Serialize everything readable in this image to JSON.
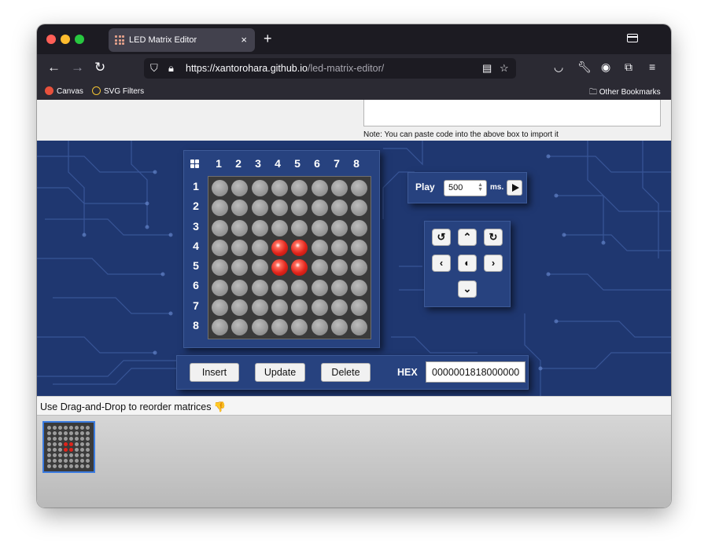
{
  "browser": {
    "tab_title": "LED Matrix Editor",
    "tab_close": "×",
    "new_tab": "+",
    "url_host": "https://xantorohara.github.io",
    "url_path": "/led-matrix-editor/",
    "bookmarks": [
      {
        "label": "Canvas",
        "color": "#e8513c"
      },
      {
        "label": "SVG Filters",
        "color": "#f1c232"
      }
    ],
    "other_bookmarks": "Other Bookmarks"
  },
  "editor": {
    "note": "Note: You can paste code into the above box to import it",
    "col_labels": [
      "1",
      "2",
      "3",
      "4",
      "5",
      "6",
      "7",
      "8"
    ],
    "row_labels": [
      "1",
      "2",
      "3",
      "4",
      "5",
      "6",
      "7",
      "8"
    ],
    "matrix": [
      [
        0,
        0,
        0,
        0,
        0,
        0,
        0,
        0
      ],
      [
        0,
        0,
        0,
        0,
        0,
        0,
        0,
        0
      ],
      [
        0,
        0,
        0,
        0,
        0,
        0,
        0,
        0
      ],
      [
        0,
        0,
        0,
        1,
        1,
        0,
        0,
        0
      ],
      [
        0,
        0,
        0,
        1,
        1,
        0,
        0,
        0
      ],
      [
        0,
        0,
        0,
        0,
        0,
        0,
        0,
        0
      ],
      [
        0,
        0,
        0,
        0,
        0,
        0,
        0,
        0
      ],
      [
        0,
        0,
        0,
        0,
        0,
        0,
        0,
        0
      ]
    ],
    "play": {
      "label": "Play",
      "interval": "500",
      "unit": "ms."
    },
    "controls": {
      "rotate_left": "↺",
      "up": "⌃",
      "rotate_right": "↻",
      "left": "‹",
      "invert": "◐",
      "right": "›",
      "down": "⌄"
    },
    "buttons": {
      "insert": "Insert",
      "update": "Update",
      "delete": "Delete"
    },
    "hex_label": "HEX",
    "hex_value": "0000001818000000",
    "drag_hint": "Use Drag-and-Drop to reorder matrices 👎"
  },
  "colors": {
    "board": "#1f3770",
    "led_on": "#e0231a",
    "led_off": "#9a9a9a"
  }
}
